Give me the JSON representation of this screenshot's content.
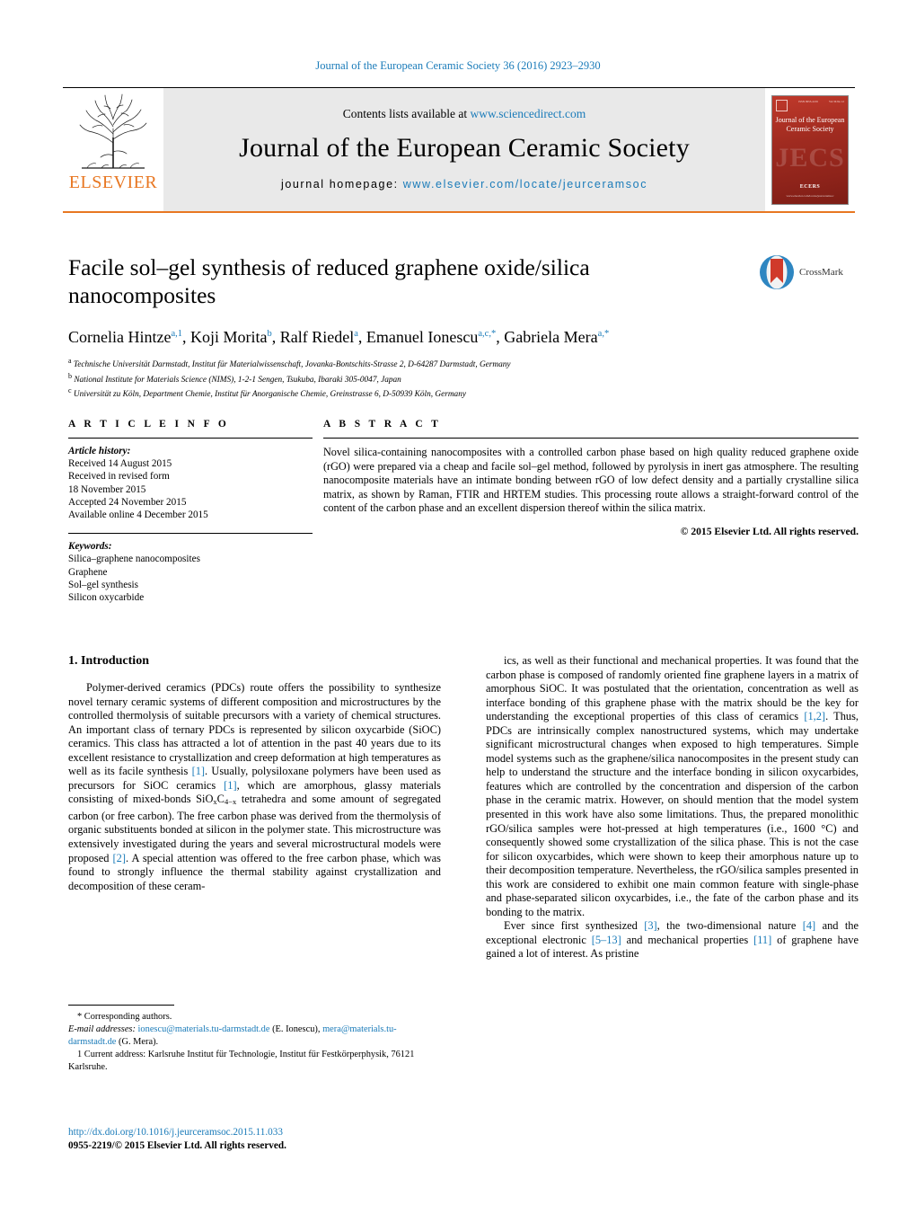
{
  "running_head": "Journal of the European Ceramic Society 36 (2016) 2923–2930",
  "masthead": {
    "publisher": "ELSEVIER",
    "contents_prefix": "Contents lists available at ",
    "contents_url": "www.sciencedirect.com",
    "journal_title": "Journal of the European Ceramic Society",
    "homepage_prefix": "journal homepage: ",
    "homepage_url": "www.elsevier.com/locate/jeurceramsoc",
    "cover": {
      "title": "Journal of the European Ceramic Society",
      "ghost_text": "JECS",
      "society": "ECERS",
      "society_sub": "www.elsevier.com/locate/jeurceramsoc",
      "top_left_text": "ISSN 0955-2219",
      "top_right_text": "Vol 36 No 12"
    },
    "accent_orange": "#e87722",
    "link_blue": "#1a7bb9"
  },
  "article": {
    "title": "Facile sol–gel synthesis of reduced graphene oxide/silica nanocomposites",
    "crossmark_label": "CrossMark",
    "authors_html": "Cornelia Hintze<sup>a,1</sup>, Koji Morita<sup>b</sup>, Ralf Riedel<sup>a</sup>, Emanuel Ionescu<sup>a,c,*</sup>, Gabriela Mera<sup>a,*</sup>",
    "affiliations": [
      {
        "mark": "a",
        "text": "Technische Universität Darmstadt, Institut für Materialwissenschaft, Jovanka-Bontschits-Strasse 2, D-64287 Darmstadt, Germany"
      },
      {
        "mark": "b",
        "text": "National Institute for Materials Science (NIMS), 1-2-1 Sengen, Tsukuba, Ibaraki 305-0047, Japan"
      },
      {
        "mark": "c",
        "text": "Universität zu Köln, Department Chemie, Institut für Anorganische Chemie, Greinstrasse 6, D-50939 Köln, Germany"
      }
    ]
  },
  "article_info": {
    "heading": "A R T I C L E   I N F O",
    "history_label": "Article history:",
    "history": [
      "Received 14 August 2015",
      "Received in revised form",
      "18 November 2015",
      "Accepted 24 November 2015",
      "Available online 4 December 2015"
    ],
    "keywords_label": "Keywords:",
    "keywords": [
      "Silica–graphene nanocomposites",
      "Graphene",
      "Sol–gel synthesis",
      "Silicon oxycarbide"
    ]
  },
  "abstract": {
    "heading": "A B S T R A C T",
    "text": "Novel silica-containing nanocomposites with a controlled carbon phase based on high quality reduced graphene oxide (rGO) were prepared via a cheap and facile sol–gel method, followed by pyrolysis in inert gas atmosphere. The resulting nanocomposite materials have an intimate bonding between rGO of low defect density and a partially crystalline silica matrix, as shown by Raman, FTIR and HRTEM studies. This processing route allows a straight-forward control of the content of the carbon phase and an excellent dispersion thereof within the silica matrix.",
    "copyright": "© 2015 Elsevier Ltd. All rights reserved."
  },
  "body": {
    "section_number_title": "1.  Introduction",
    "left_paragraph_html": "Polymer-derived ceramics (PDCs) route offers the possibility to synthesize novel ternary ceramic systems of different composition and microstructures by the controlled thermolysis of suitable precursors with a variety of chemical structures. An important class of ternary PDCs is represented by silicon oxycarbide (SiOC) ceramics. This class has attracted a lot of attention in the past 40 years due to its excellent resistance to crystallization and creep deformation at high temperatures as well as its facile synthesis <span class=\"ref\">[1]</span>. Usually, polysiloxane polymers have been used as precursors for SiOC ceramics <span class=\"ref\">[1]</span>, which are amorphous, glassy materials consisting of mixed-bonds SiO<span class=\"sub\">x</span>C<span class=\"sub\">4−x</span> tetrahedra and some amount of segregated carbon (or free carbon). The free carbon phase was derived from the thermolysis of organic substituents bonded at silicon in the polymer state. This microstructure was extensively investigated during the years and several microstructural models were proposed <span class=\"ref\">[2]</span>. A special attention was offered to the free carbon phase, which was found to strongly influence the thermal stability against crystallization and decomposition of these ceram-",
    "right_paragraph_1_html": "ics, as well as their functional and mechanical properties. It was found that the carbon phase is composed of randomly oriented fine graphene layers in a matrix of amorphous SiOC. It was postulated that the orientation, concentration as well as interface bonding of this graphene phase with the matrix should be the key for understanding the exceptional properties of this class of ceramics <span class=\"ref\">[1,2]</span>. Thus, PDCs are intrinsically complex nanostructured systems, which may undertake significant microstructural changes when exposed to high temperatures. Simple model systems such as the graphene/silica nanocomposites in the present study can help to understand the structure and the interface bonding in silicon oxycarbides, features which are controlled by the concentration and dispersion of the carbon phase in the ceramic matrix. However, on should mention that the model system presented in this work have also some limitations. Thus, the prepared monolithic rGO/silica samples were hot-pressed at high temperatures (i.e., 1600 °C) and consequently showed some crystallization of the silica phase. This is not the case for silicon oxycarbides, which were shown to keep their amorphous nature up to their decomposition temperature. Nevertheless, the rGO/silica samples presented in this work are considered to exhibit one main common feature with single-phase and phase-separated silicon oxycarbides, i.e., the fate of the carbon phase and its bonding to the matrix.",
    "right_paragraph_2_html": "Ever since first synthesized <span class=\"ref\">[3]</span>, the two-dimensional nature <span class=\"ref\">[4]</span> and the exceptional electronic <span class=\"ref\">[5–13]</span> and mechanical properties <span class=\"ref\">[11]</span> of graphene have gained a lot of interest. As pristine"
  },
  "footnotes": {
    "corresponding": "*  Corresponding authors.",
    "email_label": "E-mail addresses:",
    "email_1": "ionescu@materials.tu-darmstadt.de",
    "email_1_owner": "(E. Ionescu),",
    "email_2": "mera@materials.tu-darmstadt.de",
    "email_2_owner": "(G. Mera).",
    "current_address": "1  Current address: Karlsruhe Institut für Technologie, Institut für Festkörperphysik, 76121 Karlsruhe."
  },
  "doi_block": {
    "doi_url": "http://dx.doi.org/10.1016/j.jeurceramsoc.2015.11.033",
    "issn_line": "0955-2219/© 2015 Elsevier Ltd. All rights reserved."
  }
}
